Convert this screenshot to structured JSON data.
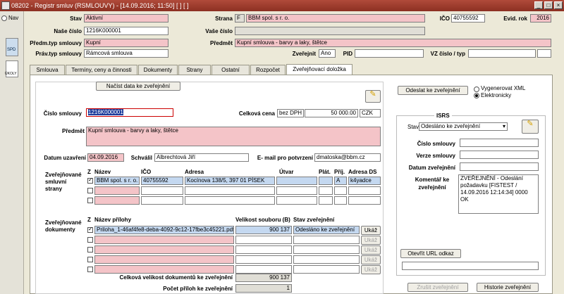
{
  "window": {
    "title": "08202 - Registr smluv (RSMLOUVY) - [14.09.2016; 11:50] [ ] [ ]"
  },
  "left_panel": {
    "nav_label": "Nav",
    "spd_label": "SPD",
    "nkoly_label": "ÚKOLY"
  },
  "header": {
    "stav_label": "Stav",
    "stav_value": "Aktivní",
    "strana_label": "Strana",
    "strana_code": "F",
    "strana_value": "BBM spol. s r. o.",
    "ico_label": "IČO",
    "ico_value": "40755592",
    "evid_rok_label": "Evid. rok",
    "evid_rok_value": "2016",
    "nase_cislo_label": "Naše číslo",
    "nase_cislo_value": "1216K000001",
    "vase_cislo_label": "Vaše číslo",
    "vase_cislo_value": "",
    "predm_typ_label": "Předm.typ smlouvy",
    "predm_typ_value": "Kupní",
    "predmet_label": "Předmět",
    "predmet_value": "Kupní smlouva - barvy a laky, štětce",
    "prav_typ_label": "Práv.typ smlouvy",
    "prav_typ_value": "Rámcová smlouva",
    "zverejnit_label": "Zveřejnit",
    "zverejnit_value": "Ano",
    "pid_label": "PID",
    "pid_value": "",
    "vz_label": "VZ číslo / typ",
    "vz_value": ""
  },
  "tabs": [
    "Smlouva",
    "Termíny, ceny a činnosti",
    "Dokumenty",
    "Strany",
    "Ostatní",
    "Rozpočet",
    "Zveřejňovací doložka"
  ],
  "form": {
    "load_button": "Načíst data ke zveřejnění",
    "cislo_label": "Číslo smlouvy",
    "cislo_value": "1216K000001",
    "celkova_label": "Celková cena",
    "celkova_dph": "bez DPH",
    "celkova_value": "50 000.00",
    "celkova_mena": "CZK",
    "predmet_label": "Předmět",
    "predmet_value": "Kupní smlouva - barvy a laky, štětce",
    "datum_label": "Datum uzavření",
    "datum_value": "04.09.2016",
    "schvalil_label": "Schválil",
    "schvalil_value": "Albrechtová Jiří",
    "email_label": "E- mail pro potvrzení",
    "email_value": "dmatoska@bbm.cz",
    "strany_label": "Zveřejňované smluvní strany",
    "strany_headers": [
      "Z",
      "Název",
      "IČO",
      "Adresa",
      "Útvar",
      "Plát.",
      "Příj.",
      "Adresa DS"
    ],
    "strany_row": {
      "nazev": "BBM spol. s r. o.",
      "ico": "40755592",
      "adresa": "Kocínova 138/5, 397 01 PÍSEK",
      "utvar": "",
      "plat": "",
      "prij": "A",
      "ds": "k4yadce"
    },
    "dokumenty_label": "Zveřejňované dokumenty",
    "dok_headers": [
      "Z",
      "Název přílohy",
      "Velikost souboru (B)",
      "Stav zveřejnění"
    ],
    "dok_row": {
      "nazev": "Priloha_1-46af4fe8-deba-4092-9c12-17fbe3c45221.pdf",
      "velikost": "900 137",
      "stav": "Odesláno ke zveřejnění",
      "button": "Ukáž"
    },
    "ukaz_label": "Ukáž",
    "celkova_velikost_label": "Celková velikost dokumentů ke zveřejnění",
    "celkova_velikost_value": "900 137",
    "pocet_label": "Počet příloh ke zveřejnění",
    "pocet_value": "1"
  },
  "right": {
    "odeslat_button": "Odeslat ke zveřejnění",
    "radio_xml": "Vygenerovat XML",
    "radio_el": "Elektronicky",
    "isrs_title": "ISRS",
    "stav_label": "Stav",
    "stav_value": "Odesláno ke zveřejnění",
    "cislo_label": "Číslo smlouvy",
    "verze_label": "Verze smlouvy",
    "datum_label": "Datum zveřejnění",
    "komentar_label": "Komentář ke zveřejnění",
    "komentar_value": "ZVEŘEJNĚNÍ - Odeslání požadavku [FISTEST / 14.09.2016 12:14:34] 0000 OK",
    "url_button": "Otevřít URL odkaz",
    "zrusit_button": "Zrušit zveřejnění",
    "historie_button": "Historie zveřejnění"
  }
}
